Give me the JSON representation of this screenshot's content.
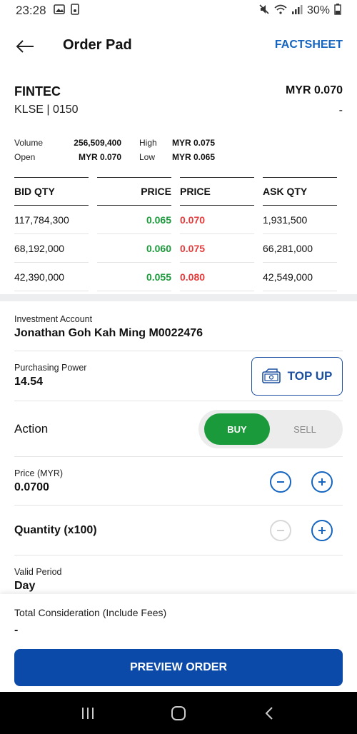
{
  "status_bar": {
    "time": "23:28",
    "battery": "30%"
  },
  "header": {
    "title": "Order Pad",
    "factsheet_label": "FACTSHEET"
  },
  "stock": {
    "symbol": "FINTEC",
    "exchange_code": "KLSE | 0150",
    "price": "MYR 0.070",
    "change": "-"
  },
  "stats": {
    "volume_label": "Volume",
    "volume": "256,509,400",
    "high_label": "High",
    "high": "MYR 0.075",
    "open_label": "Open",
    "open": "MYR 0.070",
    "low_label": "Low",
    "low": "MYR 0.065"
  },
  "order_book": {
    "headers": {
      "bid_qty": "BID QTY",
      "bid_price": "PRICE",
      "ask_price": "PRICE",
      "ask_qty": "ASK QTY"
    },
    "rows": [
      {
        "bid_qty": "117,784,300",
        "bid_price": "0.065",
        "ask_price": "0.070",
        "ask_qty": "1,931,500"
      },
      {
        "bid_qty": "68,192,000",
        "bid_price": "0.060",
        "ask_price": "0.075",
        "ask_qty": "66,281,000"
      },
      {
        "bid_qty": "42,390,000",
        "bid_price": "0.055",
        "ask_price": "0.080",
        "ask_qty": "42,549,000"
      }
    ]
  },
  "form": {
    "account_label": "Investment Account",
    "account_value": "Jonathan Goh Kah Ming M0022476",
    "purchasing_power_label": "Purchasing Power",
    "purchasing_power_value": "14.54",
    "topup_label": "TOP UP",
    "action_label": "Action",
    "buy_label": "BUY",
    "sell_label": "SELL",
    "price_label": "Price (MYR)",
    "price_value": "0.0700",
    "quantity_label": "Quantity (x100)",
    "valid_period_label": "Valid Period",
    "valid_period_value": "Day"
  },
  "footer": {
    "total_label": "Total Consideration (Include Fees)",
    "total_value": "-",
    "preview_label": "PREVIEW ORDER"
  },
  "colors": {
    "accent_blue": "#1565c0",
    "button_blue": "#0b4aa8",
    "bid_green": "#1a9a3a",
    "ask_red": "#e33b3b"
  }
}
